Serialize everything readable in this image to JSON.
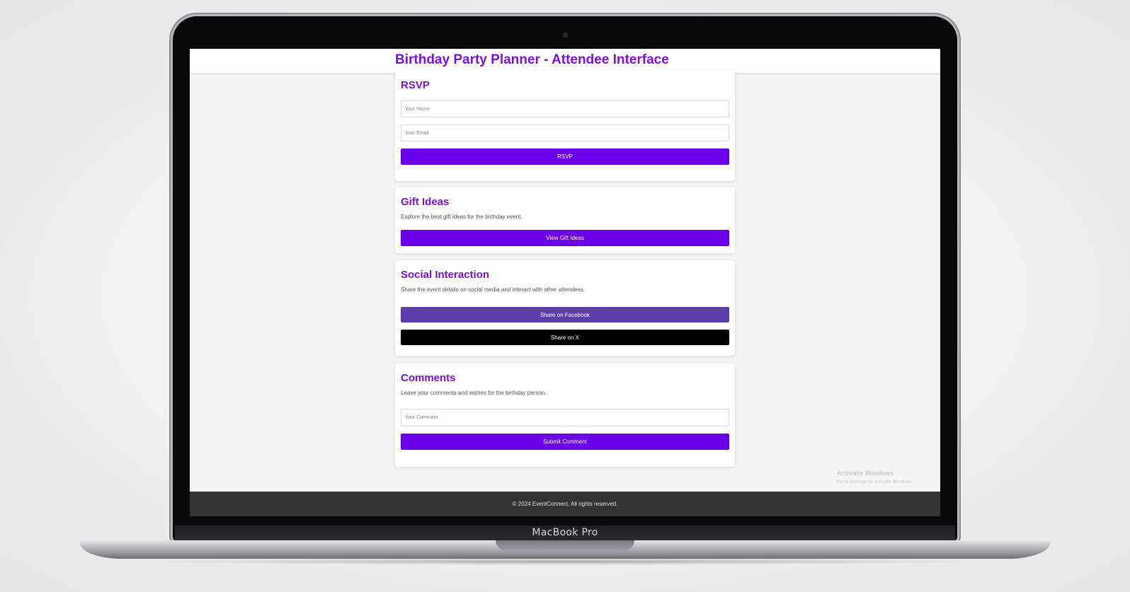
{
  "device": {
    "model_label": "MacBook Pro"
  },
  "app": {
    "title": "Birthday Party Planner - Attendee Interface",
    "accent_color": "#6a00e8",
    "title_color": "#7b12d6"
  },
  "rsvp": {
    "title": "RSVP",
    "name_placeholder": "Your Name",
    "email_placeholder": "Your Email",
    "button_label": "RSVP"
  },
  "gift_ideas": {
    "title": "Gift Ideas",
    "description": "Explore the best gift ideas for the birthday event.",
    "button_label": "View Gift Ideas"
  },
  "social": {
    "title": "Social Interaction",
    "description": "Share the event details on social media and interact with other attendees.",
    "facebook_label": "Share on Facebook",
    "x_label": "Share on X"
  },
  "comments": {
    "title": "Comments",
    "description": "Leave your comments and wishes for the birthday person.",
    "comment_placeholder": "Your Comment",
    "button_label": "Submit Comment"
  },
  "watermark": {
    "title": "Activate Windows",
    "subtitle": "Go to Settings to activate Windows."
  },
  "footer": {
    "text": "© 2024 EventConnect. All rights reserved."
  }
}
